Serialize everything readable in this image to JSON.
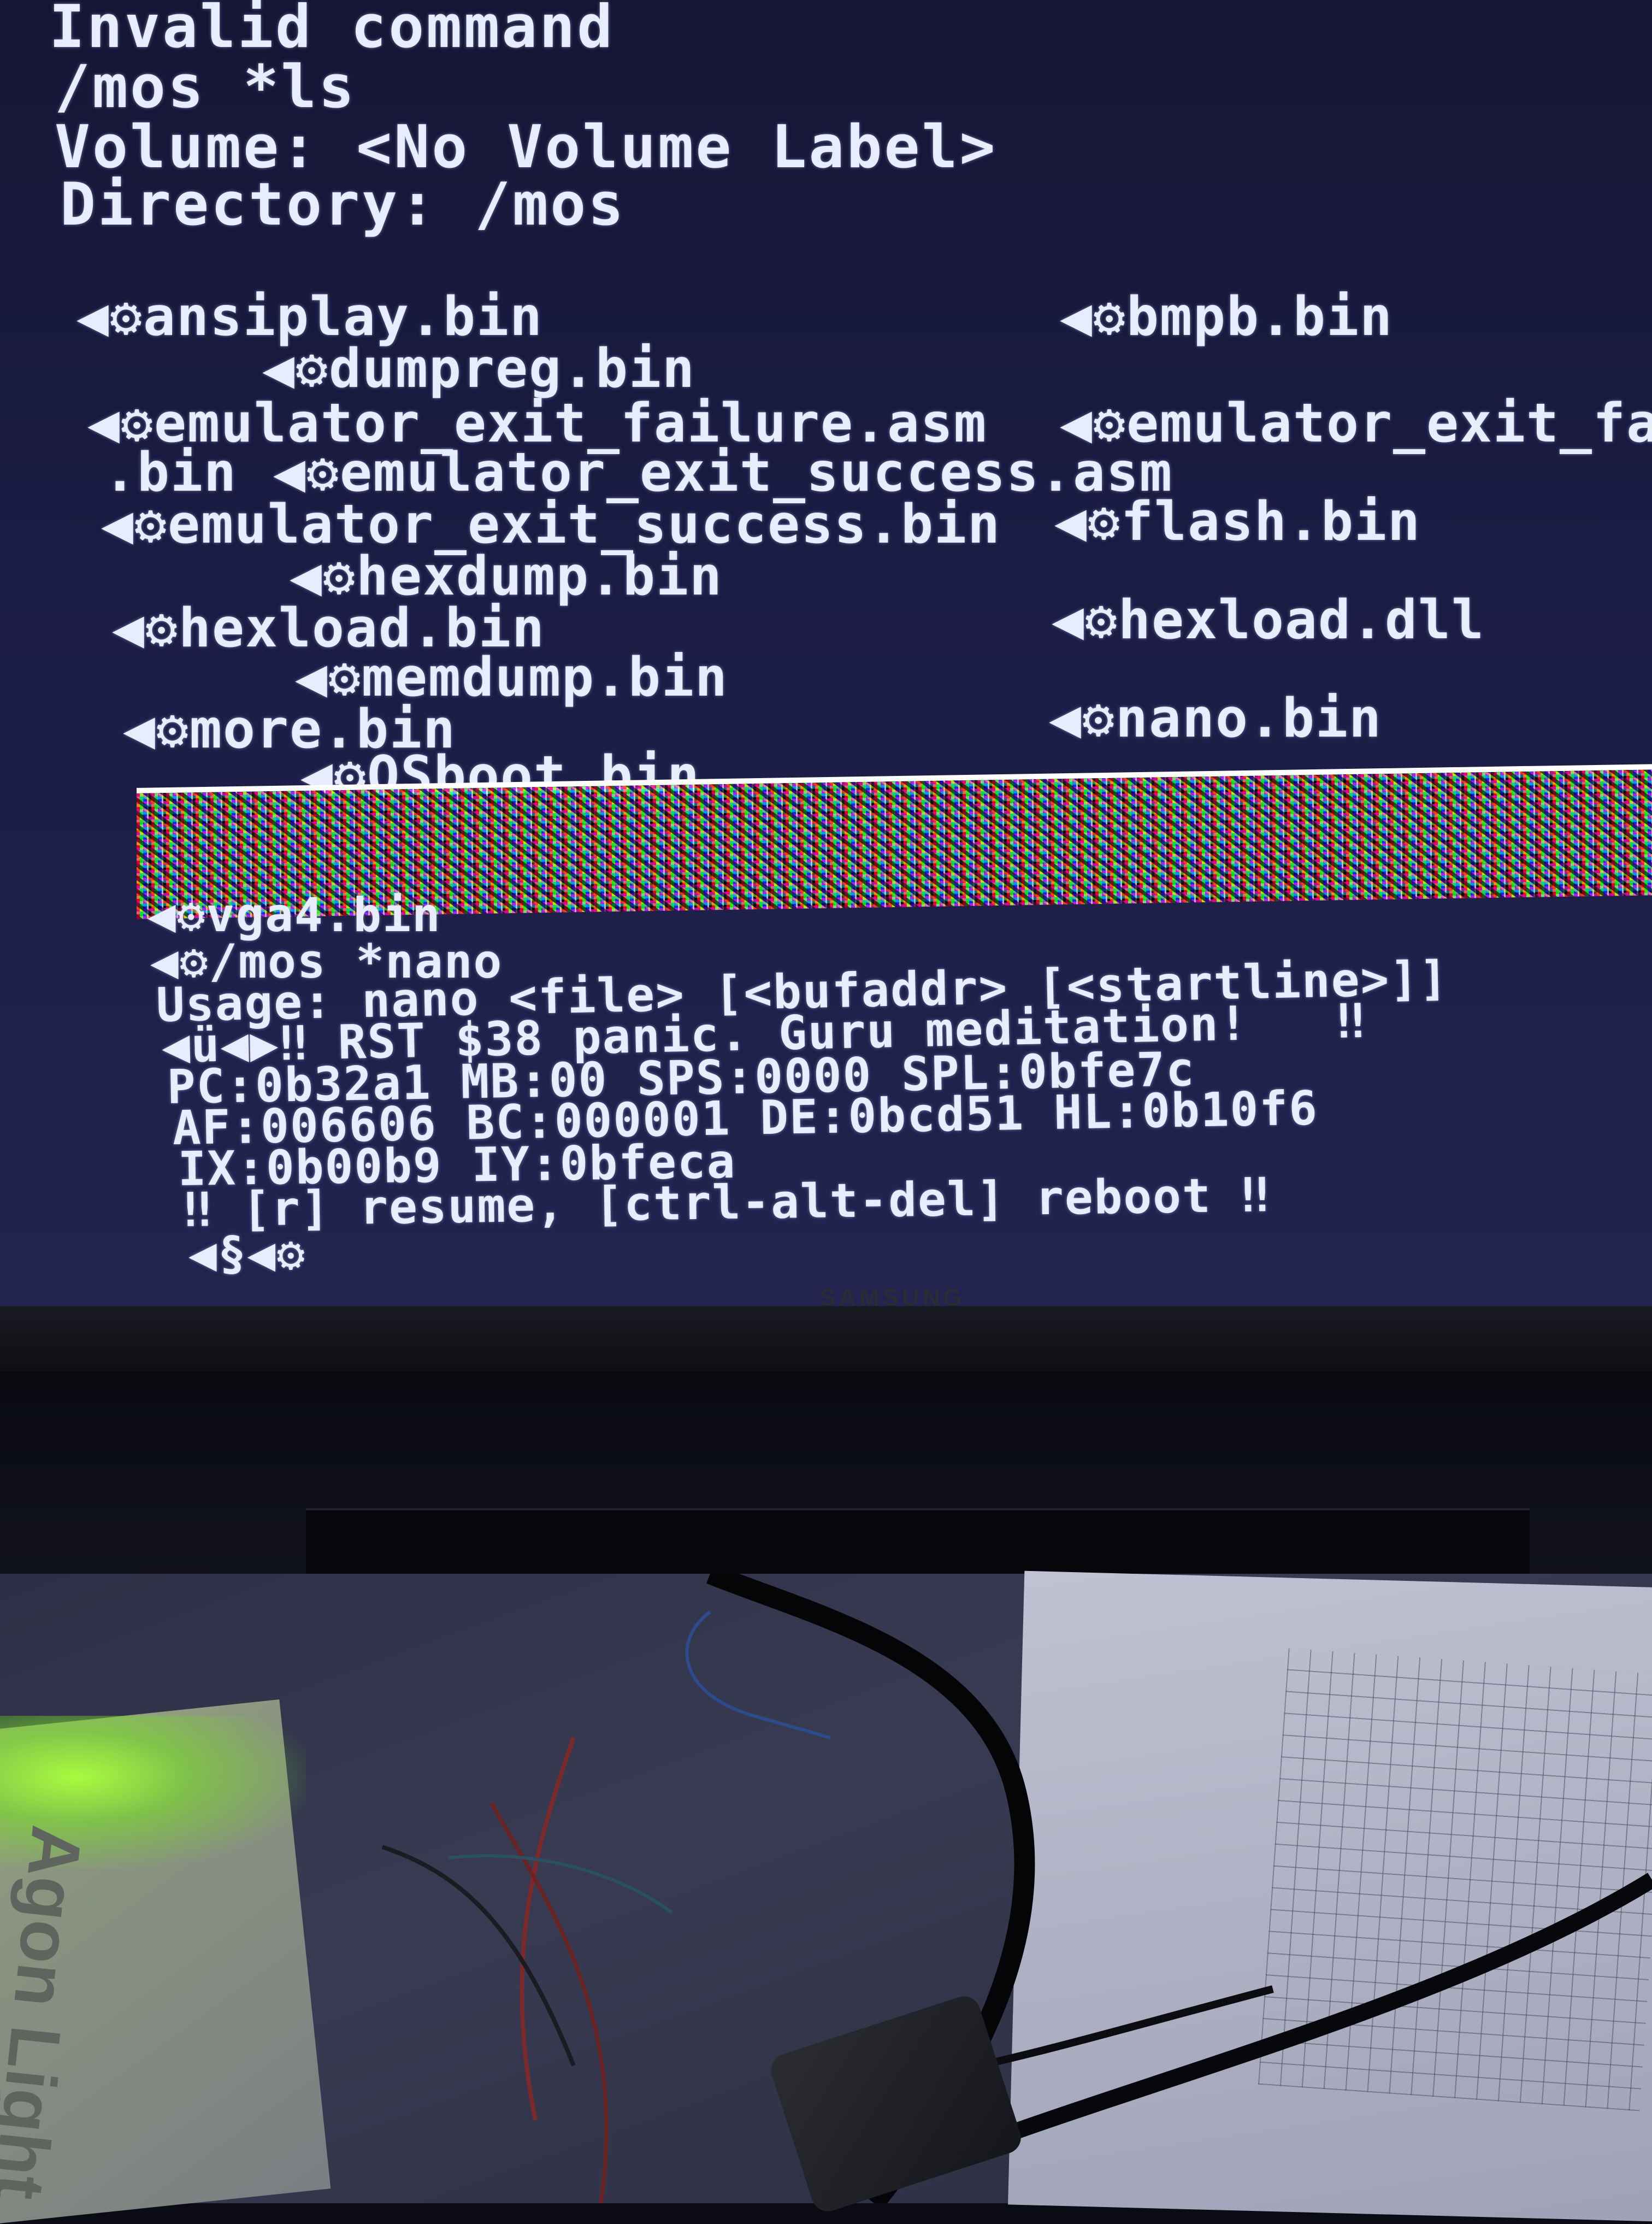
{
  "terminal": {
    "lines": [
      "Invalid command",
      "/mos *ls",
      "Volume: <No Volume Label>",
      "Directory: /mos"
    ],
    "listing": {
      "ansiplay": "◀⚙ansiplay.bin",
      "bmpb": "◀⚙bmpb.bin",
      "dumpreg": "◀⚙dumpreg.bin",
      "exit_fail_asm": "◀⚙emulator_exit_failure.asm",
      "exit_fail_bin_part": "◀⚙emulator_exit_fa",
      "bin_tail": ".bin",
      "exit_success_asm": "◀⚙emulator_exit_success.asm",
      "exit_success_bin": "◀⚙emulator_exit_success.bin",
      "flash": "◀⚙flash.bin",
      "hexdump": "◀⚙hexdump.bin",
      "hexload_bin": "◀⚙hexload.bin",
      "hexload_dll": "◀⚙hexload.dll",
      "memdump": "◀⚙memdump.bin",
      "more": "◀⚙more.bin",
      "nano": "◀⚙nano.bin",
      "osboot": "◀⚙OSboot.bin",
      "vga4": "◀⚙vga4.bin"
    },
    "after": [
      "◀⚙/mos *nano",
      "Usage: nano <file> [<bufaddr> [<startline>]]",
      "◀ü◀▶‼ RST $38 panic. Guru meditation!   ‼",
      "PC:0b32a1 MB:00 SPS:0000 SPL:0bfe7c",
      "AF:006606 BC:000001 DE:0bcd51 HL:0b10f6",
      "IX:0b00b9 IY:0bfeca",
      "‼ [r] resume, [ctrl-alt-del] reboot ‼",
      "◀§◀⚙"
    ]
  },
  "monitor": {
    "brand": "SAMSUNG"
  },
  "device": {
    "label": "Agon Light"
  },
  "colors": {
    "screen_bg": "#1b1c44",
    "text": "#e8ecff",
    "device_led": "#a8ff3c"
  }
}
